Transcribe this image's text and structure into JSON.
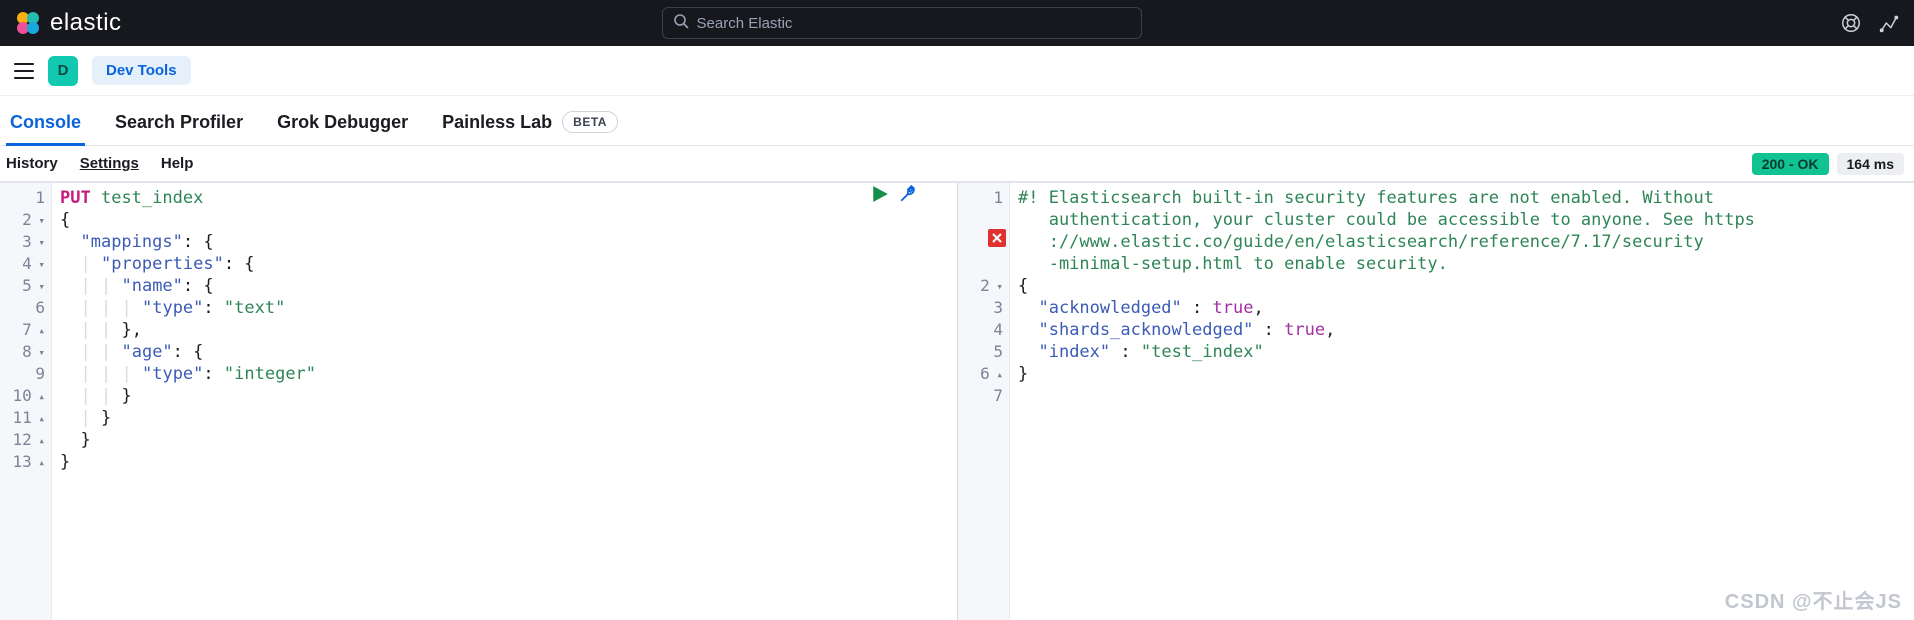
{
  "brand": {
    "name": "elastic"
  },
  "search": {
    "placeholder": "Search Elastic"
  },
  "breadcrumb": {
    "space_initial": "D",
    "current": "Dev Tools"
  },
  "tabs": [
    {
      "id": "console",
      "label": "Console",
      "active": true
    },
    {
      "id": "profiler",
      "label": "Search Profiler",
      "active": false
    },
    {
      "id": "grok",
      "label": "Grok Debugger",
      "active": false
    },
    {
      "id": "painless",
      "label": "Painless Lab",
      "active": false,
      "beta": "BETA"
    }
  ],
  "toolrow": {
    "history": "History",
    "settings": "Settings",
    "help": "Help"
  },
  "response_status": {
    "code": "200 - OK",
    "time": "164 ms"
  },
  "request": {
    "method": "PUT",
    "path": "test_index",
    "lines": [
      {
        "n": "1",
        "fold": "",
        "html": "<span class='tok-method'>PUT</span> <span class='tok-ident'>test_index</span>"
      },
      {
        "n": "2",
        "fold": "fold",
        "html": "<span class='tok-punct'>{</span>"
      },
      {
        "n": "3",
        "fold": "fold",
        "html": "  <span class='tok-key'>\"mappings\"</span><span class='tok-punct'>: {</span>"
      },
      {
        "n": "4",
        "fold": "fold",
        "html": "  <span class='guide'>|</span> <span class='tok-key'>\"properties\"</span><span class='tok-punct'>: {</span>"
      },
      {
        "n": "5",
        "fold": "fold",
        "html": "  <span class='guide'>|</span> <span class='guide'>|</span> <span class='tok-key'>\"name\"</span><span class='tok-punct'>: {</span>"
      },
      {
        "n": "6",
        "fold": "",
        "html": "  <span class='guide'>|</span> <span class='guide'>|</span> <span class='guide'>|</span> <span class='tok-key'>\"type\"</span><span class='tok-punct'>:</span> <span class='tok-str'>\"text\"</span>"
      },
      {
        "n": "7",
        "fold": "foldup",
        "html": "  <span class='guide'>|</span> <span class='guide'>|</span> <span class='tok-punct'>},</span>"
      },
      {
        "n": "8",
        "fold": "fold",
        "html": "  <span class='guide'>|</span> <span class='guide'>|</span> <span class='tok-key'>\"age\"</span><span class='tok-punct'>: {</span>"
      },
      {
        "n": "9",
        "fold": "",
        "html": "  <span class='guide'>|</span> <span class='guide'>|</span> <span class='guide'>|</span> <span class='tok-key'>\"type\"</span><span class='tok-punct'>:</span> <span class='tok-str'>\"integer\"</span>"
      },
      {
        "n": "10",
        "fold": "foldup",
        "html": "  <span class='guide'>|</span> <span class='guide'>|</span> <span class='tok-punct'>}</span>"
      },
      {
        "n": "11",
        "fold": "foldup",
        "html": "  <span class='guide'>|</span> <span class='tok-punct'>}</span>"
      },
      {
        "n": "12",
        "fold": "foldup",
        "html": "  <span class='tok-punct'>}</span>"
      },
      {
        "n": "13",
        "fold": "foldup",
        "html": "<span class='tok-punct'>}</span>"
      }
    ]
  },
  "response": {
    "lines": [
      {
        "n": "1",
        "fold": "",
        "html": "<span class='tok-comment'>#! Elasticsearch built-in security features are not enabled. Without</span>"
      },
      {
        "n": "",
        "fold": "",
        "html": "<span class='tok-comment'>   authentication, your cluster could be accessible to anyone. See https</span>"
      },
      {
        "n": "",
        "fold": "",
        "html": "<span class='tok-comment'>   ://www.elastic.co/guide/en/elasticsearch/reference/7.17/security</span>"
      },
      {
        "n": "",
        "fold": "",
        "html": "<span class='tok-comment'>   -minimal-setup.html to enable security.</span>"
      },
      {
        "n": "2",
        "fold": "fold",
        "html": "<span class='tok-punct'>{</span>"
      },
      {
        "n": "3",
        "fold": "",
        "html": "  <span class='tok-key'>\"acknowledged\"</span> <span class='tok-punct'>:</span> <span class='tok-bool'>true</span><span class='tok-punct'>,</span>"
      },
      {
        "n": "4",
        "fold": "",
        "html": "  <span class='tok-key'>\"shards_acknowledged\"</span> <span class='tok-punct'>:</span> <span class='tok-bool'>true</span><span class='tok-punct'>,</span>"
      },
      {
        "n": "5",
        "fold": "",
        "html": "  <span class='tok-key'>\"index\"</span> <span class='tok-punct'>:</span> <span class='tok-str'>\"test_index\"</span>"
      },
      {
        "n": "6",
        "fold": "foldup",
        "html": "<span class='tok-punct'>}</span>"
      },
      {
        "n": "7",
        "fold": "",
        "html": ""
      }
    ]
  },
  "watermark": "CSDN @不止会JS"
}
